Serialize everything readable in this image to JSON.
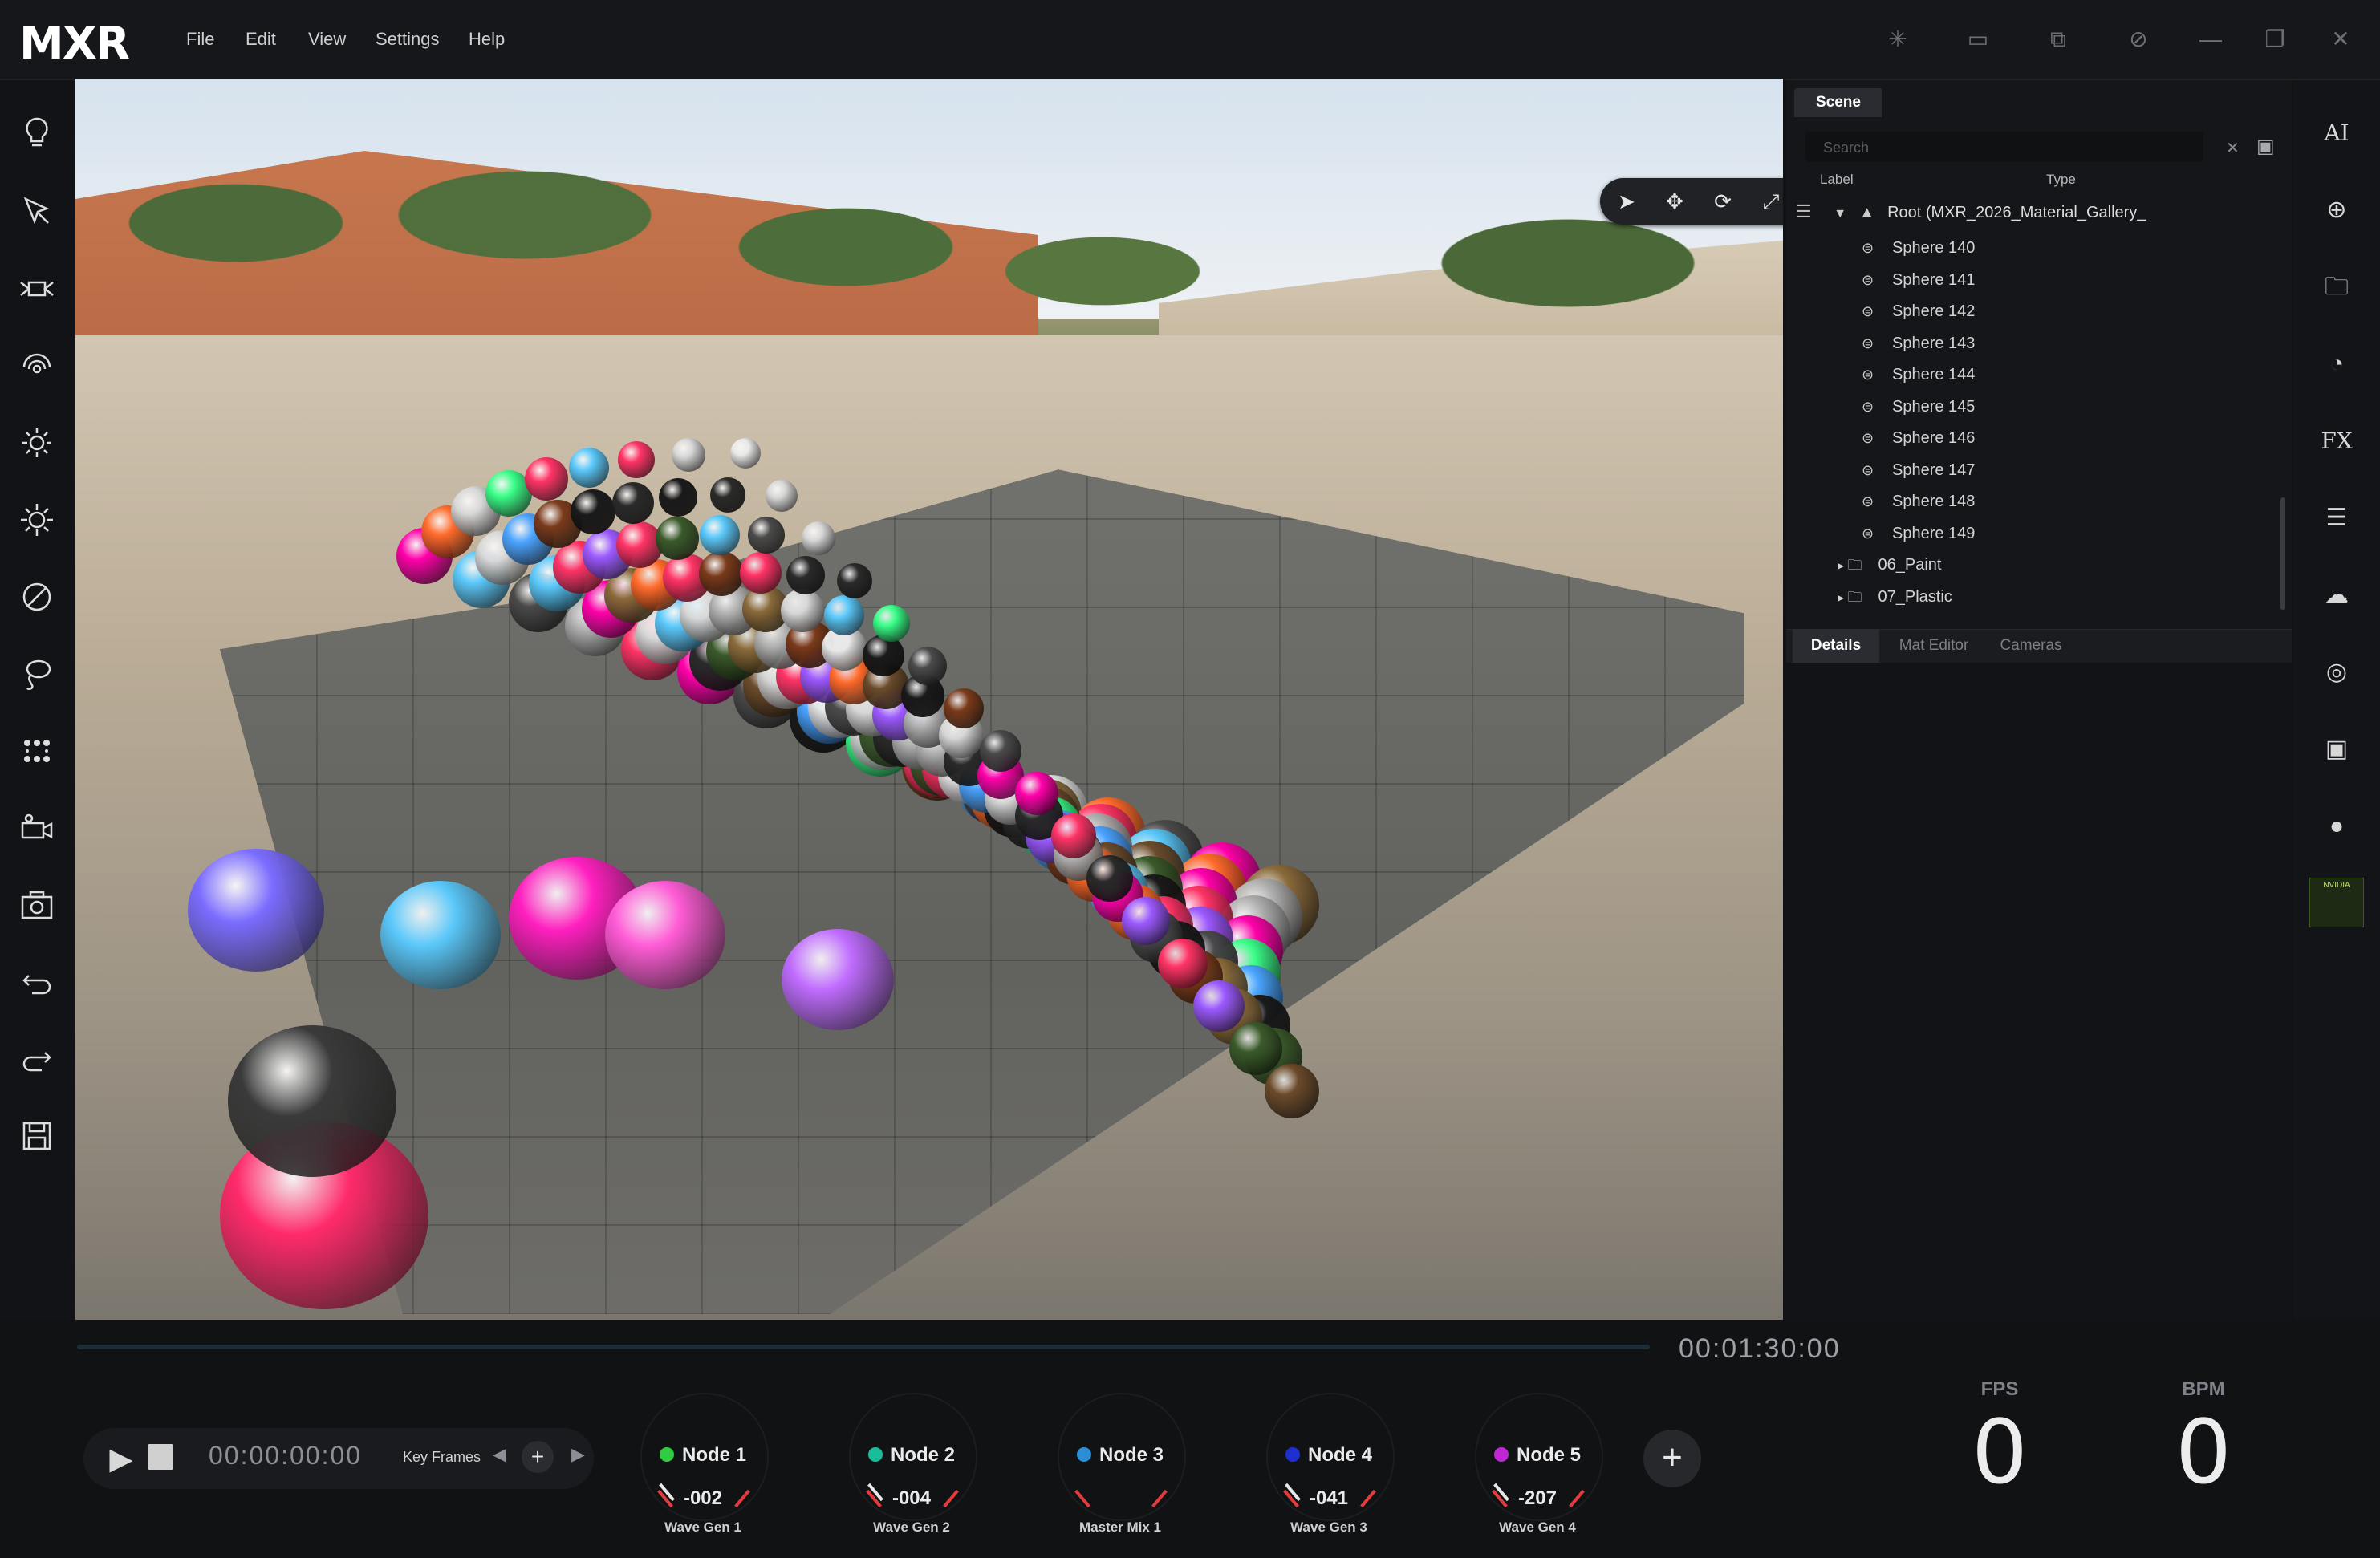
{
  "app": {
    "logo": "MXR"
  },
  "menu": [
    "File",
    "Edit",
    "View",
    "Settings",
    "Help"
  ],
  "window_icons": [
    "sparkle-icon",
    "vr-headset-icon",
    "resize-icon",
    "hide-icon",
    "minimize-icon",
    "restore-icon",
    "close-icon"
  ],
  "left_toolbar": [
    "light-bulb-icon",
    "select-arrow-icon",
    "projector-icon",
    "face-scan-icon",
    "sun-low-icon",
    "sun-high-icon",
    "no-entry-icon",
    "lasso-icon",
    "dots-grid-icon",
    "camera-tripod-icon",
    "render-icon",
    "undo-icon",
    "redo-icon",
    "save-icon"
  ],
  "gizmo": [
    "select-icon",
    "move-icon",
    "rotate-icon",
    "scale-icon",
    "expand-icon"
  ],
  "scene_panel": {
    "tab": "Scene",
    "search_placeholder": "Search",
    "columns": {
      "label": "Label",
      "type": "Type"
    },
    "root": "Root (MXR_2026_Material_Gallery_",
    "items": [
      "Sphere 140",
      "Sphere 141",
      "Sphere 142",
      "Sphere 143",
      "Sphere 144",
      "Sphere 145",
      "Sphere 146",
      "Sphere 147",
      "Sphere 148",
      "Sphere 149"
    ],
    "folders": [
      "06_Paint",
      "07_Plastic"
    ]
  },
  "lower_tabs": [
    "Details",
    "Mat Editor",
    "Cameras"
  ],
  "right_toolbar": {
    "ai": "AI",
    "fx": "FX",
    "nvidia": "NVIDIA"
  },
  "timeline": {
    "end_time": "00:01:30:00",
    "current_time": "00:00:00:00",
    "keyframes_label": "Key Frames",
    "progress": 0
  },
  "nodes": [
    {
      "title": "Node 1",
      "value": "-002",
      "sub": "Wave Gen 1",
      "color": "#2ecc40"
    },
    {
      "title": "Node 2",
      "value": "-004",
      "sub": "Wave Gen 2",
      "color": "#1abc9c"
    },
    {
      "title": "Node 3",
      "value": "",
      "sub": "Master Mix 1",
      "color": "#2a8fd6"
    },
    {
      "title": "Node 4",
      "value": "-041",
      "sub": "Wave Gen 3",
      "color": "#1f2ed0"
    },
    {
      "title": "Node 5",
      "value": "-207",
      "sub": "Wave Gen 4",
      "color": "#c026d3"
    }
  ],
  "meters": {
    "fps_label": "FPS",
    "fps": "0",
    "bpm_label": "BPM",
    "bpm": "0"
  }
}
